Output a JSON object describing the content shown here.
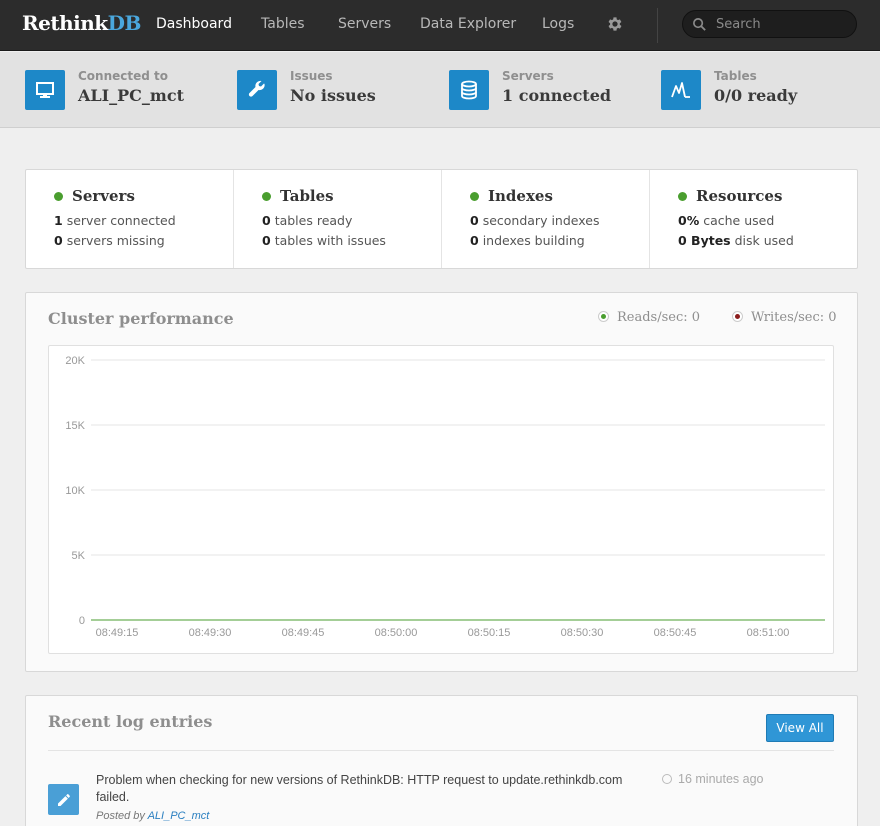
{
  "brand": {
    "part1": "Rethink",
    "part2": "DB"
  },
  "nav": {
    "items": [
      {
        "label": "Dashboard",
        "active": true
      },
      {
        "label": "Tables"
      },
      {
        "label": "Servers"
      },
      {
        "label": "Data Explorer"
      },
      {
        "label": "Logs"
      }
    ],
    "settings_icon": "gear-icon",
    "search": {
      "placeholder": "Search",
      "value": ""
    }
  },
  "status": [
    {
      "label": "Connected to",
      "value": "ALI_PC_mct",
      "icon": "monitor-icon"
    },
    {
      "label": "Issues",
      "value": "No issues",
      "icon": "wrench-icon"
    },
    {
      "label": "Servers",
      "value": "1 connected",
      "icon": "database-icon"
    },
    {
      "label": "Tables",
      "value": "0/0 ready",
      "icon": "table-icon"
    }
  ],
  "summary": [
    {
      "title": "Servers",
      "lines": [
        {
          "num": "1",
          "text": "server connected"
        },
        {
          "num": "0",
          "text": "servers missing"
        }
      ]
    },
    {
      "title": "Tables",
      "lines": [
        {
          "num": "0",
          "text": "tables ready"
        },
        {
          "num": "0",
          "text": "tables with issues"
        }
      ]
    },
    {
      "title": "Indexes",
      "lines": [
        {
          "num": "0",
          "text": "secondary indexes"
        },
        {
          "num": "0",
          "text": "indexes building"
        }
      ]
    },
    {
      "title": "Resources",
      "lines": [
        {
          "num": "0%",
          "text": "cache used"
        },
        {
          "num": "0 Bytes",
          "text": "disk used"
        }
      ]
    }
  ],
  "performance": {
    "title": "Cluster performance",
    "reads_label": "Reads/sec: 0",
    "writes_label": "Writes/sec: 0"
  },
  "chart_data": {
    "type": "line",
    "title": "Cluster performance",
    "xlabel": "",
    "ylabel": "",
    "x": [
      "08:49:15",
      "08:49:30",
      "08:49:45",
      "08:50:00",
      "08:50:15",
      "08:50:30",
      "08:50:45",
      "08:51:00"
    ],
    "y_ticks": [
      "20K",
      "15K",
      "10K",
      "5K",
      "0"
    ],
    "ylim": [
      0,
      20000
    ],
    "grid": true,
    "series": [
      {
        "name": "Reads/sec",
        "color": "#4a9e2f",
        "values": [
          0,
          0,
          0,
          0,
          0,
          0,
          0,
          0
        ]
      },
      {
        "name": "Writes/sec",
        "color": "#8b1d1d",
        "values": [
          0,
          0,
          0,
          0,
          0,
          0,
          0,
          0
        ]
      }
    ]
  },
  "logs": {
    "title": "Recent log entries",
    "view_all": "View All",
    "entries": [
      {
        "message": "Problem when checking for new versions of RethinkDB: HTTP request to update.rethinkdb.com failed.",
        "time": "16 minutes ago",
        "posted_by_prefix": "Posted by",
        "server": "ALI_PC_mct"
      }
    ]
  },
  "colors": {
    "accent": "#1d88c8",
    "navbar": "#2c2c2c",
    "ok": "#4a9e2f"
  }
}
